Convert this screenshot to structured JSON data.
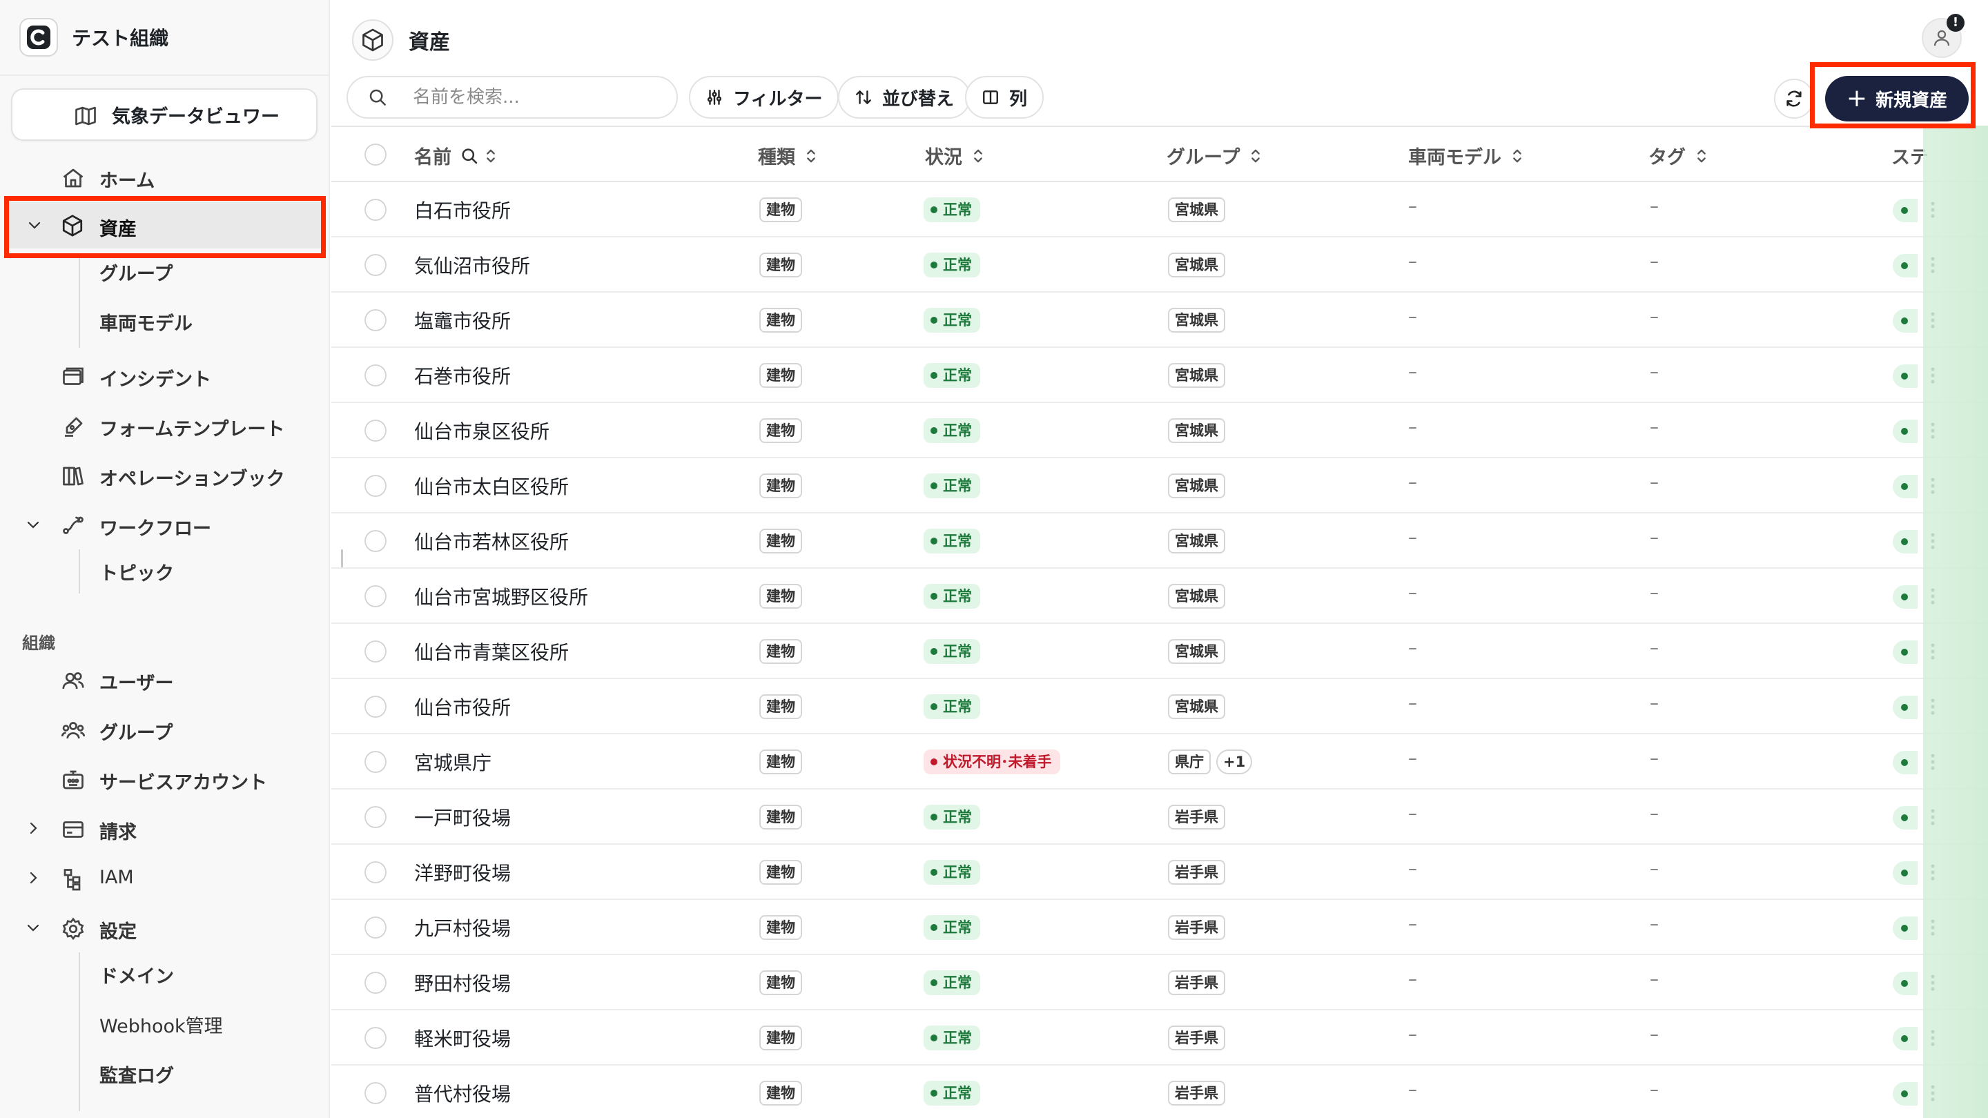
{
  "org": {
    "name": "テスト組織"
  },
  "sidebar": {
    "weather_viewer": "気象データビュワー",
    "home": "ホーム",
    "assets": "資産",
    "assets_children": [
      "グループ",
      "車両モデル"
    ],
    "incidents": "インシデント",
    "form_templates": "フォームテンプレート",
    "operation_books": "オペレーションブック",
    "workflow": "ワークフロー",
    "workflow_children": [
      "トピック"
    ],
    "org_section": "組織",
    "users": "ユーザー",
    "groups": "グループ",
    "service_accounts": "サービスアカウント",
    "billing": "請求",
    "iam": "IAM",
    "settings": "設定",
    "settings_children": [
      "ドメイン",
      "Webhook管理",
      "監査ログ"
    ]
  },
  "page": {
    "title": "資産",
    "user_alert": "!"
  },
  "toolbar": {
    "search_placeholder": "名前を検索...",
    "filter": "フィルター",
    "sort": "並び替え",
    "columns": "列",
    "new_asset": "新規資産"
  },
  "table": {
    "headers": {
      "name": "名前",
      "type": "種類",
      "status": "状況",
      "group": "グループ",
      "vehicle_model": "車両モデル",
      "tags": "タグ",
      "stage": "ステ"
    },
    "empty": "–",
    "rows": [
      {
        "name": "白石市役所",
        "type": "建物",
        "status": "正常",
        "status_kind": "ok",
        "group": "宮城県"
      },
      {
        "name": "気仙沼市役所",
        "type": "建物",
        "status": "正常",
        "status_kind": "ok",
        "group": "宮城県"
      },
      {
        "name": "塩竈市役所",
        "type": "建物",
        "status": "正常",
        "status_kind": "ok",
        "group": "宮城県"
      },
      {
        "name": "石巻市役所",
        "type": "建物",
        "status": "正常",
        "status_kind": "ok",
        "group": "宮城県"
      },
      {
        "name": "仙台市泉区役所",
        "type": "建物",
        "status": "正常",
        "status_kind": "ok",
        "group": "宮城県"
      },
      {
        "name": "仙台市太白区役所",
        "type": "建物",
        "status": "正常",
        "status_kind": "ok",
        "group": "宮城県"
      },
      {
        "name": "仙台市若林区役所",
        "type": "建物",
        "status": "正常",
        "status_kind": "ok",
        "group": "宮城県"
      },
      {
        "name": "仙台市宮城野区役所",
        "type": "建物",
        "status": "正常",
        "status_kind": "ok",
        "group": "宮城県"
      },
      {
        "name": "仙台市青葉区役所",
        "type": "建物",
        "status": "正常",
        "status_kind": "ok",
        "group": "宮城県"
      },
      {
        "name": "仙台市役所",
        "type": "建物",
        "status": "正常",
        "status_kind": "ok",
        "group": "宮城県"
      },
      {
        "name": "宮城県庁",
        "type": "建物",
        "status": "状況不明･未着手",
        "status_kind": "unknown",
        "group": "県庁",
        "group_extra": "+1"
      },
      {
        "name": "一戸町役場",
        "type": "建物",
        "status": "正常",
        "status_kind": "ok",
        "group": "岩手県"
      },
      {
        "name": "洋野町役場",
        "type": "建物",
        "status": "正常",
        "status_kind": "ok",
        "group": "岩手県"
      },
      {
        "name": "九戸村役場",
        "type": "建物",
        "status": "正常",
        "status_kind": "ok",
        "group": "岩手県"
      },
      {
        "name": "野田村役場",
        "type": "建物",
        "status": "正常",
        "status_kind": "ok",
        "group": "岩手県"
      },
      {
        "name": "軽米町役場",
        "type": "建物",
        "status": "正常",
        "status_kind": "ok",
        "group": "岩手県"
      },
      {
        "name": "普代村役場",
        "type": "建物",
        "status": "正常",
        "status_kind": "ok",
        "group": "岩手県"
      }
    ]
  },
  "colors": {
    "accent_button": "#1b2240",
    "status_ok_bg": "#e2f6e7",
    "status_ok_text": "#1e7a3c",
    "status_unknown_bg": "#fde4e6",
    "status_unknown_text": "#c01a2c",
    "highlight": "#ff2a00"
  }
}
